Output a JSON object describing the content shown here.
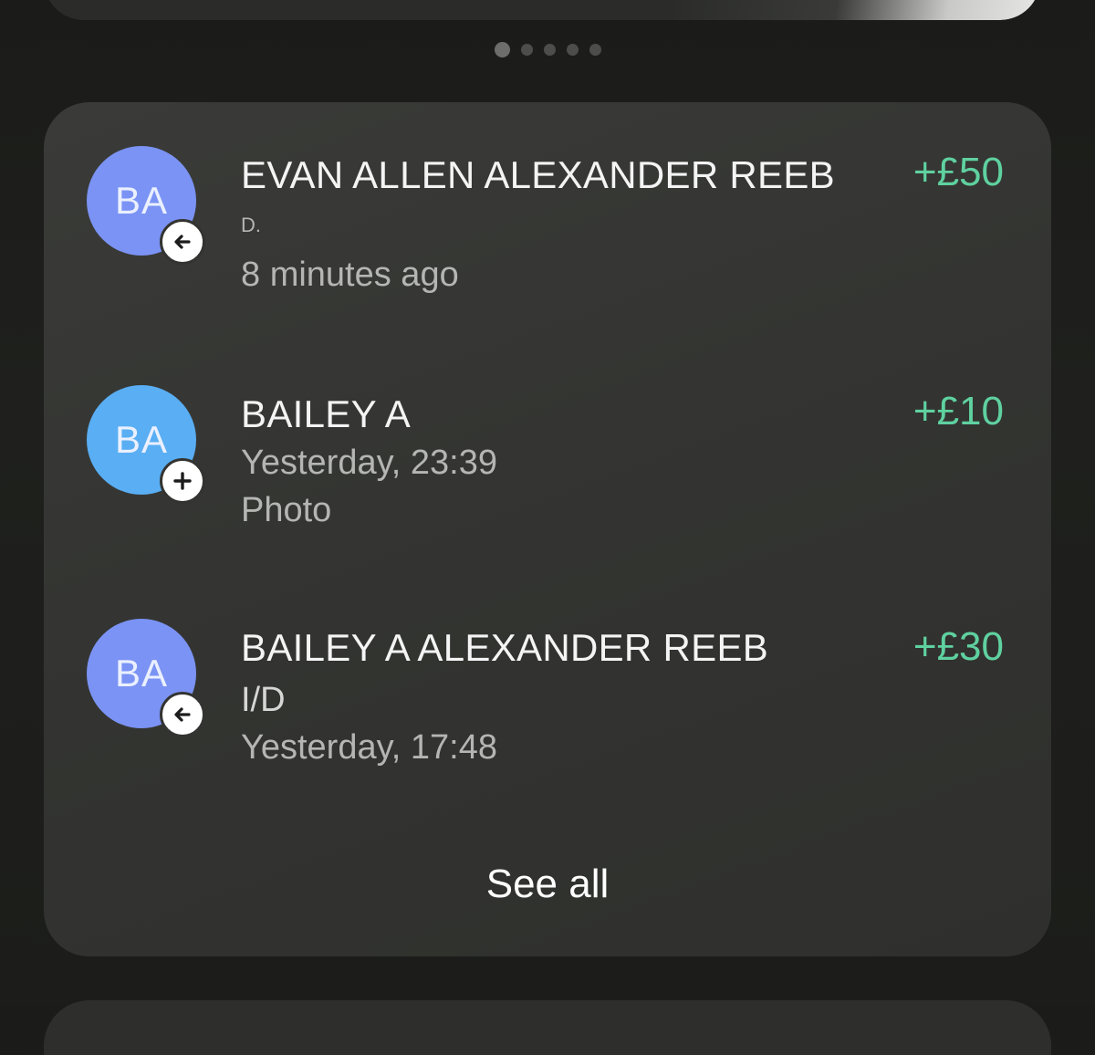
{
  "carousel": {
    "page_count": 5,
    "active_index": 0
  },
  "transactions": [
    {
      "initials": "BA",
      "avatar_color": "#7b93f4",
      "badge_icon": "arrow-left-icon",
      "title": "EVAN ALLEN ALEXANDER REEB",
      "subtitle": "D.",
      "time": "8 minutes ago",
      "amount": "+£50",
      "amount_color": "#5fd1a0"
    },
    {
      "initials": "BA",
      "avatar_color": "#5aaef3",
      "badge_icon": "plus-icon",
      "title": "BAILEY A",
      "time": "Yesterday, 23:39",
      "note": "Photo",
      "amount": "+£10",
      "amount_color": "#5fd1a0"
    },
    {
      "initials": "BA",
      "avatar_color": "#7b93f4",
      "badge_icon": "arrow-left-icon",
      "title": "BAILEY A ALEXANDER REEB",
      "subtitle": "I/D",
      "time": "Yesterday, 17:48",
      "amount": "+£30",
      "amount_color": "#5fd1a0"
    }
  ],
  "see_all_label": "See all"
}
